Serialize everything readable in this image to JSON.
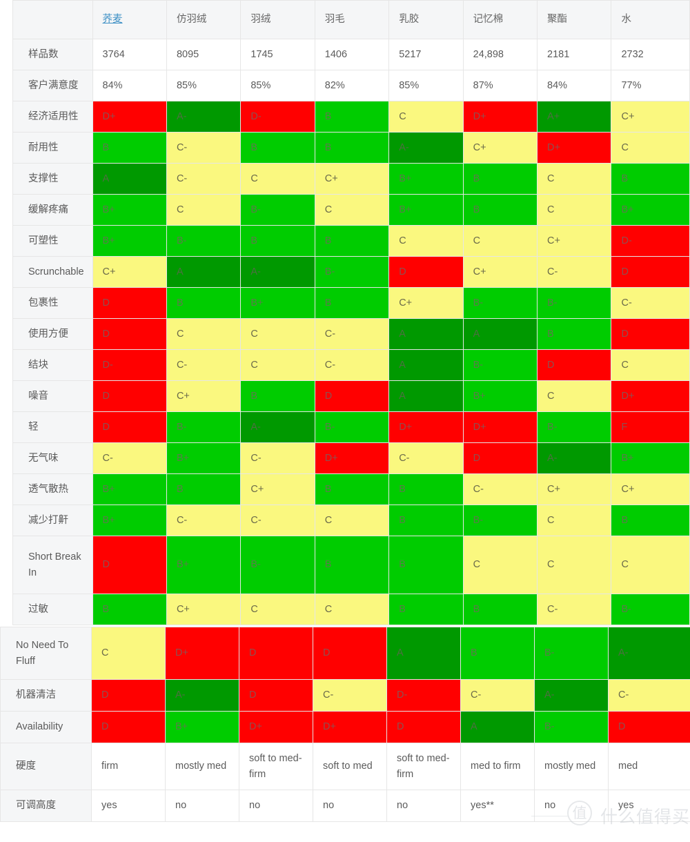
{
  "table": {
    "corner_label": "",
    "columns": [
      {
        "label": "荞麦",
        "is_link": true
      },
      {
        "label": "仿羽绒",
        "is_link": false
      },
      {
        "label": "羽绒",
        "is_link": false
      },
      {
        "label": "羽毛",
        "is_link": false
      },
      {
        "label": "乳胶",
        "is_link": false
      },
      {
        "label": "记忆棉",
        "is_link": false
      },
      {
        "label": "聚酯",
        "is_link": false
      },
      {
        "label": "水",
        "is_link": false
      }
    ],
    "plain_rows": [
      {
        "label": "样品数",
        "values": [
          "3764",
          "8095",
          "1745",
          "1406",
          "5217",
          "24,898",
          "2181",
          "2732"
        ]
      },
      {
        "label": "客户满意度",
        "values": [
          "84%",
          "85%",
          "85%",
          "82%",
          "85%",
          "87%",
          "84%",
          "77%"
        ]
      }
    ],
    "grade_rows": [
      {
        "label": "经济适用性",
        "grades": [
          "D+",
          "A-",
          "D-",
          "B",
          "C",
          "D+",
          "A+",
          "C+"
        ],
        "colors": [
          "red",
          "darkgreen",
          "red",
          "green",
          "yellow",
          "red",
          "darkgreen",
          "yellow"
        ]
      },
      {
        "label": "耐用性",
        "grades": [
          "B",
          "C-",
          "B",
          "B",
          "A-",
          "C+",
          "D+",
          "C"
        ],
        "colors": [
          "green",
          "yellow",
          "green",
          "green",
          "darkgreen",
          "yellow",
          "red",
          "yellow"
        ]
      },
      {
        "label": "支撑性",
        "grades": [
          "A",
          "C-",
          "C",
          "C+",
          "B+",
          "B",
          "C",
          "B"
        ],
        "colors": [
          "darkgreen",
          "yellow",
          "yellow",
          "yellow",
          "green",
          "green",
          "yellow",
          "green"
        ]
      },
      {
        "label": "缓解疼痛",
        "grades": [
          "B+",
          "C",
          "B-",
          "C",
          "B+",
          "B",
          "C",
          "B+"
        ],
        "colors": [
          "green",
          "yellow",
          "green",
          "yellow",
          "green",
          "green",
          "yellow",
          "green"
        ]
      },
      {
        "label": "可塑性",
        "grades": [
          "B+",
          "B-",
          "B",
          "B",
          "C",
          "C",
          "C+",
          "D-"
        ],
        "colors": [
          "green",
          "green",
          "green",
          "green",
          "yellow",
          "yellow",
          "yellow",
          "red"
        ]
      },
      {
        "label": "Scrunchable",
        "grades": [
          "C+",
          "A",
          "A-",
          "B-",
          "D",
          "C+",
          "C-",
          "D"
        ],
        "colors": [
          "yellow",
          "darkgreen",
          "darkgreen",
          "green",
          "red",
          "yellow",
          "yellow",
          "red"
        ]
      },
      {
        "label": "包裹性",
        "grades": [
          "D",
          "B",
          "B+",
          "B",
          "C+",
          "B-",
          "B-",
          "C-"
        ],
        "colors": [
          "red",
          "green",
          "green",
          "green",
          "yellow",
          "green",
          "green",
          "yellow"
        ]
      },
      {
        "label": "使用方便",
        "grades": [
          "D",
          "C",
          "C",
          "C-",
          "A",
          "A",
          "B",
          "D"
        ],
        "colors": [
          "red",
          "yellow",
          "yellow",
          "yellow",
          "darkgreen",
          "darkgreen",
          "green",
          "red"
        ]
      },
      {
        "label": "结块",
        "grades": [
          "D-",
          "C-",
          "C",
          "C-",
          "A",
          "B-",
          "D",
          "C"
        ],
        "colors": [
          "red",
          "yellow",
          "yellow",
          "yellow",
          "darkgreen",
          "green",
          "red",
          "yellow"
        ]
      },
      {
        "label": "噪音",
        "grades": [
          "D",
          "C+",
          "B",
          "D",
          "A",
          "B+",
          "C",
          "D+"
        ],
        "colors": [
          "red",
          "yellow",
          "green",
          "red",
          "darkgreen",
          "green",
          "yellow",
          "red"
        ]
      },
      {
        "label": "轻",
        "grades": [
          "D",
          "B-",
          "A-",
          "B-",
          "D+",
          "D+",
          "B-",
          "F"
        ],
        "colors": [
          "red",
          "green",
          "darkgreen",
          "green",
          "red",
          "red",
          "green",
          "red"
        ]
      },
      {
        "label": "无气味",
        "grades": [
          "C-",
          "B+",
          "C-",
          "D+",
          "C-",
          "D",
          "A-",
          "B+"
        ],
        "colors": [
          "yellow",
          "green",
          "yellow",
          "red",
          "yellow",
          "red",
          "darkgreen",
          "green"
        ]
      },
      {
        "label": "透气散热",
        "grades": [
          "B+",
          "B",
          "C+",
          "B",
          "B",
          "C-",
          "C+",
          "C+"
        ],
        "colors": [
          "green",
          "green",
          "yellow",
          "green",
          "green",
          "yellow",
          "yellow",
          "yellow"
        ]
      },
      {
        "label": "减少打鼾",
        "grades": [
          "B+",
          "C-",
          "C-",
          "C",
          "B",
          "B-",
          "C",
          "B"
        ],
        "colors": [
          "green",
          "yellow",
          "yellow",
          "yellow",
          "green",
          "green",
          "yellow",
          "green"
        ]
      },
      {
        "label": "Short Break In",
        "grades": [
          "D",
          "B+",
          "B-",
          "B",
          "B",
          "C",
          "C",
          "C"
        ],
        "colors": [
          "red",
          "green",
          "green",
          "green",
          "green",
          "yellow",
          "yellow",
          "yellow"
        ]
      },
      {
        "label": "过敏",
        "grades": [
          "B",
          "C+",
          "C",
          "C",
          "B",
          "B",
          "C-",
          "B-"
        ],
        "colors": [
          "green",
          "yellow",
          "yellow",
          "yellow",
          "green",
          "green",
          "yellow",
          "green"
        ]
      }
    ],
    "grade_rows_bottom": [
      {
        "label": "No Need To Fluff",
        "grades": [
          "C",
          "D+",
          "D",
          "D",
          "A",
          "B",
          "B-",
          "A-"
        ],
        "colors": [
          "yellow",
          "red",
          "red",
          "red",
          "darkgreen",
          "green",
          "green",
          "darkgreen"
        ]
      },
      {
        "label": "机器清洁",
        "grades": [
          "D",
          "A-",
          "D",
          "C-",
          "D-",
          "C-",
          "A-",
          "C-"
        ],
        "colors": [
          "red",
          "darkgreen",
          "red",
          "yellow",
          "red",
          "yellow",
          "darkgreen",
          "yellow"
        ]
      },
      {
        "label": "Availability",
        "grades": [
          "D",
          "B+",
          "D+",
          "D+",
          "D",
          "A",
          "B-",
          "D"
        ],
        "colors": [
          "red",
          "green",
          "red",
          "red",
          "red",
          "darkgreen",
          "green",
          "red"
        ]
      }
    ],
    "plain_rows_bottom": [
      {
        "label": "硬度",
        "values": [
          "firm",
          "mostly med",
          "soft to med- firm",
          "soft to med",
          "soft to med- firm",
          "med to firm",
          "mostly med",
          "med"
        ]
      },
      {
        "label": "可调高度",
        "values": [
          "yes",
          "no",
          "no",
          "no",
          "no",
          "yes**",
          "no",
          "yes"
        ]
      }
    ]
  },
  "watermark": {
    "mark": "值",
    "text": "什么值得买"
  }
}
